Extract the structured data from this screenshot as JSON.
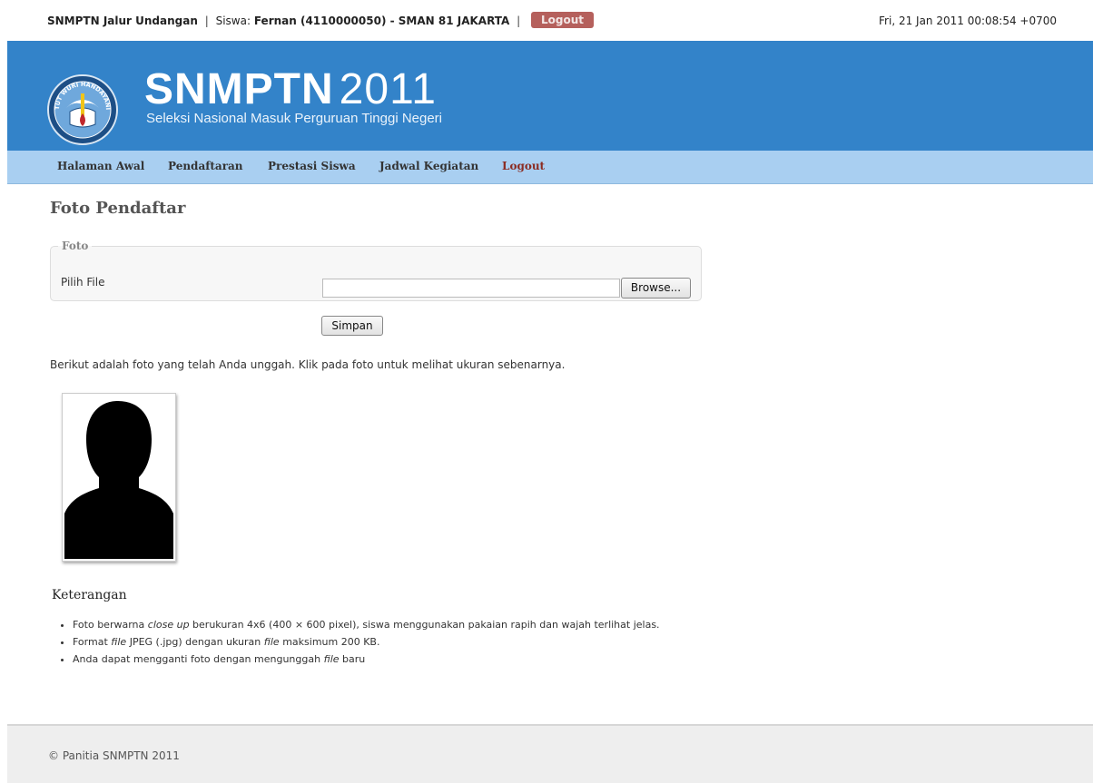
{
  "topbar": {
    "app_name": "SNMPTN Jalur Undangan",
    "siswa_label": "Siswa:",
    "student_info": "Fernan (4110000050) - SMAN 81 JAKARTA",
    "logout_label": "Logout",
    "datetime": "Fri, 21 Jan 2011 00:08:54 +0700"
  },
  "banner": {
    "title": "SNMPTN",
    "year": "2011",
    "subtitle": "Seleksi Nasional Masuk Perguruan Tinggi Negeri",
    "emblem_text": "TUT WURI HANDAYANI"
  },
  "nav": {
    "items": [
      "Halaman Awal",
      "Pendaftaran",
      "Prestasi Siswa",
      "Jadwal Kegiatan",
      "Logout"
    ]
  },
  "main": {
    "page_title": "Foto Pendaftar",
    "fieldset_legend": "Foto",
    "file_label": "Pilih File",
    "file_value": "",
    "browse_label": "Browse...",
    "save_label": "Simpan",
    "info_text": "Berikut adalah foto yang telah Anda unggah. Klik pada foto untuk melihat ukuran sebenarnya.",
    "notes_title": "Keterangan",
    "notes": [
      {
        "pre": "Foto berwarna ",
        "em": "close up",
        "post": " berukuran 4x6 (400 × 600 pixel), siswa menggunakan pakaian rapih dan wajah terlihat jelas."
      },
      {
        "pre": "Format ",
        "em": "file",
        "mid": " JPEG (.jpg) dengan ukuran ",
        "em2": "file",
        "post": " maksimum 200 KB."
      },
      {
        "pre": "Anda dapat mengganti foto dengan mengunggah ",
        "em": "file",
        "post": " baru"
      }
    ]
  },
  "footer": {
    "copyright": "© Panitia SNMPTN 2011"
  },
  "colors": {
    "banner": "#3383c9",
    "navbar": "#a9cff1",
    "logout_pill": "#b5605c",
    "nav_logout": "#8b2c22",
    "footer": "#eeeeee"
  }
}
